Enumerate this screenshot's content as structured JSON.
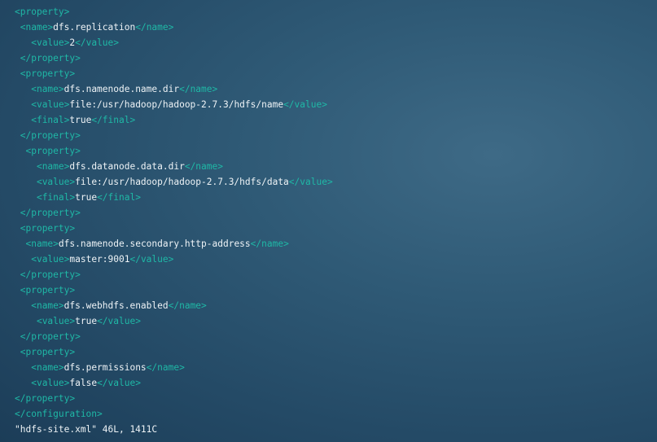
{
  "editor": {
    "lines": [
      {
        "indent": "",
        "parts": [
          {
            "t": "tag",
            "v": "<property>"
          }
        ]
      },
      {
        "indent": " ",
        "parts": [
          {
            "t": "tag",
            "v": "<name>"
          },
          {
            "t": "txt",
            "v": "dfs.replication"
          },
          {
            "t": "tag",
            "v": "</name>"
          }
        ]
      },
      {
        "indent": "   ",
        "parts": [
          {
            "t": "tag",
            "v": "<value>"
          },
          {
            "t": "txt",
            "v": "2"
          },
          {
            "t": "tag",
            "v": "</value>"
          }
        ]
      },
      {
        "indent": " ",
        "parts": [
          {
            "t": "tag",
            "v": "</property>"
          }
        ]
      },
      {
        "indent": " ",
        "parts": [
          {
            "t": "tag",
            "v": "<property>"
          }
        ]
      },
      {
        "indent": "   ",
        "parts": [
          {
            "t": "tag",
            "v": "<name>"
          },
          {
            "t": "txt",
            "v": "dfs.namenode.name.dir"
          },
          {
            "t": "tag",
            "v": "</name>"
          }
        ]
      },
      {
        "indent": "   ",
        "parts": [
          {
            "t": "tag",
            "v": "<value>"
          },
          {
            "t": "txt",
            "v": "file:/usr/hadoop/hadoop-2.7.3/hdfs/name"
          },
          {
            "t": "tag",
            "v": "</value>"
          }
        ]
      },
      {
        "indent": "   ",
        "parts": [
          {
            "t": "tag",
            "v": "<final>"
          },
          {
            "t": "txt",
            "v": "true"
          },
          {
            "t": "tag",
            "v": "</final>"
          }
        ]
      },
      {
        "indent": " ",
        "parts": [
          {
            "t": "tag",
            "v": "</property>"
          }
        ]
      },
      {
        "indent": "  ",
        "parts": [
          {
            "t": "tag",
            "v": "<property>"
          }
        ]
      },
      {
        "indent": "    ",
        "parts": [
          {
            "t": "tag",
            "v": "<name>"
          },
          {
            "t": "txt",
            "v": "dfs.datanode.data.dir"
          },
          {
            "t": "tag",
            "v": "</name>"
          }
        ]
      },
      {
        "indent": "    ",
        "parts": [
          {
            "t": "tag",
            "v": "<value>"
          },
          {
            "t": "txt",
            "v": "file:/usr/hadoop/hadoop-2.7.3/hdfs/data"
          },
          {
            "t": "tag",
            "v": "</value>"
          }
        ]
      },
      {
        "indent": "    ",
        "parts": [
          {
            "t": "tag",
            "v": "<final>"
          },
          {
            "t": "txt",
            "v": "true"
          },
          {
            "t": "tag",
            "v": "</final>"
          }
        ]
      },
      {
        "indent": " ",
        "parts": [
          {
            "t": "tag",
            "v": "</property>"
          }
        ]
      },
      {
        "indent": " ",
        "parts": [
          {
            "t": "tag",
            "v": "<property>"
          }
        ]
      },
      {
        "indent": "  ",
        "parts": [
          {
            "t": "tag",
            "v": "<name>"
          },
          {
            "t": "txt",
            "v": "dfs.namenode.secondary.http-address"
          },
          {
            "t": "tag",
            "v": "</name>"
          }
        ]
      },
      {
        "indent": "   ",
        "parts": [
          {
            "t": "tag",
            "v": "<value>"
          },
          {
            "t": "txt",
            "v": "master:9001"
          },
          {
            "t": "tag",
            "v": "</value>"
          }
        ]
      },
      {
        "indent": " ",
        "parts": [
          {
            "t": "tag",
            "v": "</property>"
          }
        ]
      },
      {
        "indent": " ",
        "parts": [
          {
            "t": "tag",
            "v": "<property>"
          }
        ]
      },
      {
        "indent": "   ",
        "parts": [
          {
            "t": "tag",
            "v": "<name>"
          },
          {
            "t": "txt",
            "v": "dfs.webhdfs.enabled"
          },
          {
            "t": "tag",
            "v": "</name>"
          }
        ]
      },
      {
        "indent": "    ",
        "parts": [
          {
            "t": "tag",
            "v": "<value>"
          },
          {
            "t": "txt",
            "v": "true"
          },
          {
            "t": "tag",
            "v": "</value>"
          }
        ]
      },
      {
        "indent": " ",
        "parts": [
          {
            "t": "tag",
            "v": "</property>"
          }
        ]
      },
      {
        "indent": " ",
        "parts": [
          {
            "t": "tag",
            "v": "<property>"
          }
        ]
      },
      {
        "indent": "   ",
        "parts": [
          {
            "t": "tag",
            "v": "<name>"
          },
          {
            "t": "txt",
            "v": "dfs.permissions"
          },
          {
            "t": "tag",
            "v": "</name>"
          }
        ]
      },
      {
        "indent": "   ",
        "parts": [
          {
            "t": "tag",
            "v": "<value>"
          },
          {
            "t": "txt",
            "v": "false"
          },
          {
            "t": "tag",
            "v": "</value>"
          }
        ]
      },
      {
        "indent": "",
        "parts": [
          {
            "t": "tag",
            "v": "</property>"
          }
        ]
      },
      {
        "indent": "",
        "parts": [
          {
            "t": "tag",
            "v": "</configuration>"
          }
        ]
      }
    ]
  },
  "status_bar": {
    "text": "\"hdfs-site.xml\" 46L, 1411C"
  },
  "colors": {
    "tag": "#1fb8a6",
    "text": "#eef3f6",
    "background": "#2b5470"
  }
}
